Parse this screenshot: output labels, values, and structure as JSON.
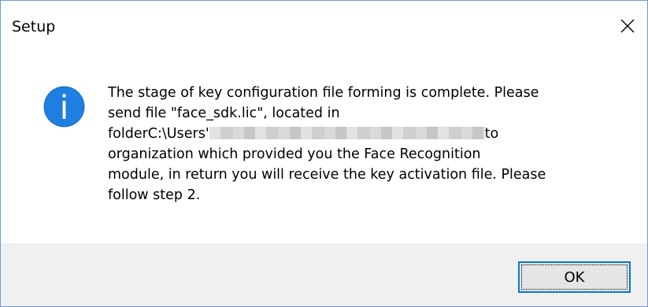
{
  "window": {
    "title": "Setup"
  },
  "dialog": {
    "icon": "information-icon",
    "message_lines": [
      "The stage of key configuration file forming is complete. Please",
      "send file \"face_sdk.lic\", located in",
      "organization which provided you the Face Recognition",
      "module, in return you will receive the key activation file. Please",
      "follow step 2."
    ],
    "path_prefix": "folderC:\\Users'",
    "path_suffix": "to"
  },
  "buttons": {
    "ok_label": "OK"
  },
  "colors": {
    "accent": "#0078d7",
    "footer_bg": "#f0f0f0",
    "window_border": "#6b9bd6"
  }
}
